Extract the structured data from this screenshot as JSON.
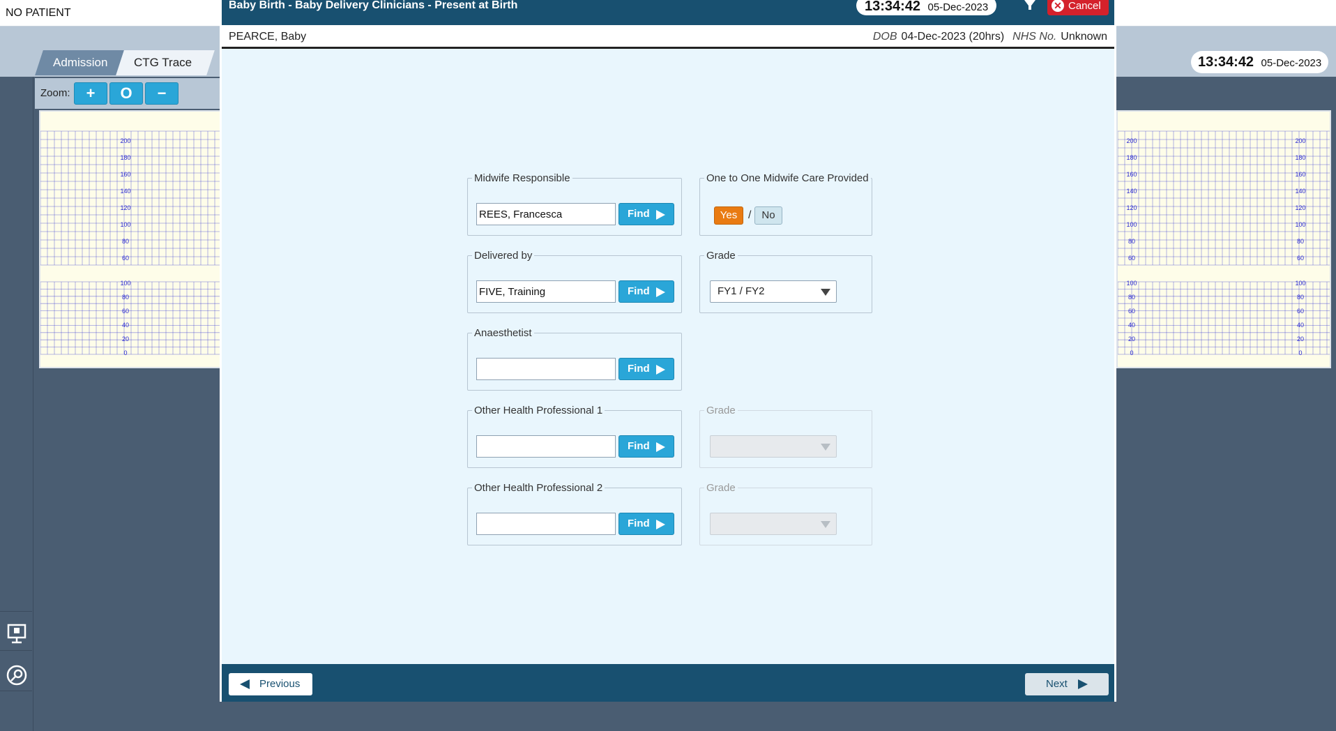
{
  "app": {
    "patient_status": "NO PATIENT",
    "tabs": [
      {
        "label": "Admission"
      },
      {
        "label": "CTG Trace"
      }
    ],
    "zoom": {
      "label": "Zoom:",
      "in": "+",
      "reset": "O",
      "out": "−"
    },
    "clock": {
      "time": "13:34:42",
      "date": "05-Dec-2023"
    },
    "ctg_scale_fhr": [
      "200",
      "180",
      "160",
      "140",
      "120",
      "100",
      "80",
      "60"
    ],
    "ctg_scale_toco": [
      "100",
      "80",
      "60",
      "40",
      "20",
      "0"
    ]
  },
  "modal": {
    "title": "Baby Birth - Baby Delivery Clinicians - Present at Birth",
    "clock": {
      "time": "13:34:42",
      "date": "05-Dec-2023"
    },
    "cancel_label": "Cancel",
    "patient": {
      "name": "PEARCE, Baby",
      "dob_label": "DOB",
      "dob_value": "04-Dec-2023 (20hrs)",
      "nhs_label": "NHS No.",
      "nhs_value": "Unknown"
    },
    "fields": {
      "midwife": {
        "legend": "Midwife Responsible",
        "value": "REES, Francesca",
        "find": "Find"
      },
      "one_to_one": {
        "legend": "One to One Midwife Care Provided",
        "yes": "Yes",
        "sep": "/",
        "no": "No",
        "selected": "Yes"
      },
      "delivered_by": {
        "legend": "Delivered by",
        "value": "FIVE, Training",
        "find": "Find"
      },
      "grade": {
        "legend": "Grade",
        "value": "FY1 / FY2"
      },
      "anaesthetist": {
        "legend": "Anaesthetist",
        "value": "",
        "find": "Find"
      },
      "other1": {
        "legend": "Other Health Professional 1",
        "value": "",
        "find": "Find"
      },
      "grade1": {
        "legend": "Grade",
        "value": ""
      },
      "other2": {
        "legend": "Other Health Professional 2",
        "value": "",
        "find": "Find"
      },
      "grade2": {
        "legend": "Grade",
        "value": ""
      }
    },
    "footer": {
      "previous": "Previous",
      "next": "Next"
    }
  },
  "colors": {
    "header_blue": "#185070",
    "find_blue": "#2aa6d8",
    "yes_orange": "#e97b12",
    "cancel_red": "#d4212b",
    "ctg_grid": "#2a2ad0"
  }
}
